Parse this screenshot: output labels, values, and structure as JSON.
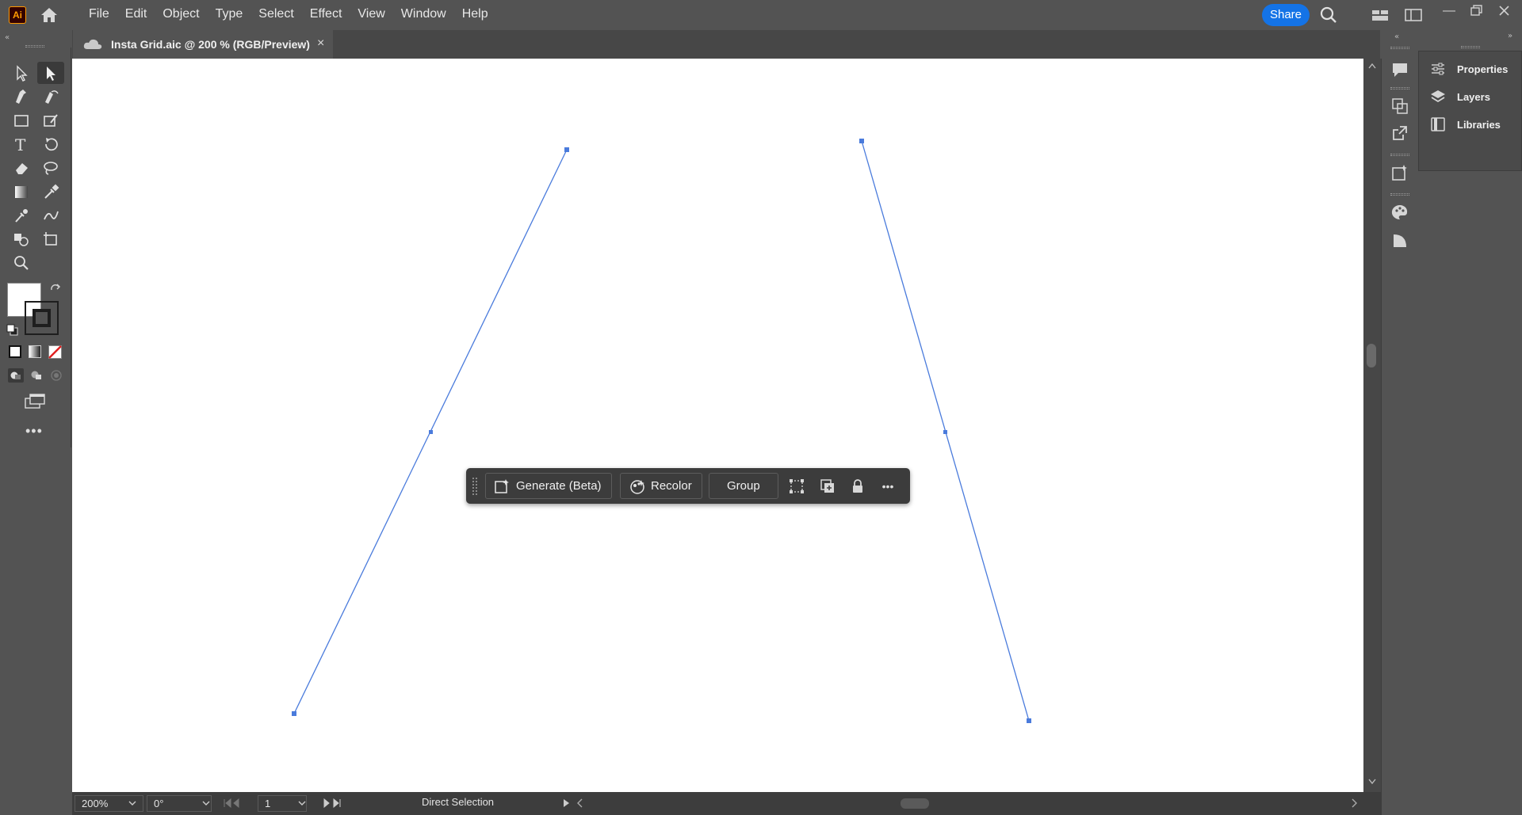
{
  "app": {
    "logo_text": "Ai"
  },
  "menu": [
    "File",
    "Edit",
    "Object",
    "Type",
    "Select",
    "Effect",
    "View",
    "Window",
    "Help"
  ],
  "share_label": "Share",
  "document_tab": {
    "title": "Insta Grid.aic @ 200 % (RGB/Preview)",
    "close_glyph": "×"
  },
  "status": {
    "zoom": "200%",
    "rotation": "0°",
    "artboard": "1",
    "tool_name": "Direct Selection"
  },
  "context_toolbar": {
    "generate_label": "Generate (Beta)",
    "recolor_label": "Recolor",
    "group_label": "Group",
    "more_glyph": "•••"
  },
  "panels": [
    "Properties",
    "Layers",
    "Libraries"
  ],
  "colors": {
    "selection_blue": "#4a7bdc",
    "share_blue": "#1473e6",
    "ui_bg": "#535353",
    "panel_dark": "#3c3c3c"
  }
}
